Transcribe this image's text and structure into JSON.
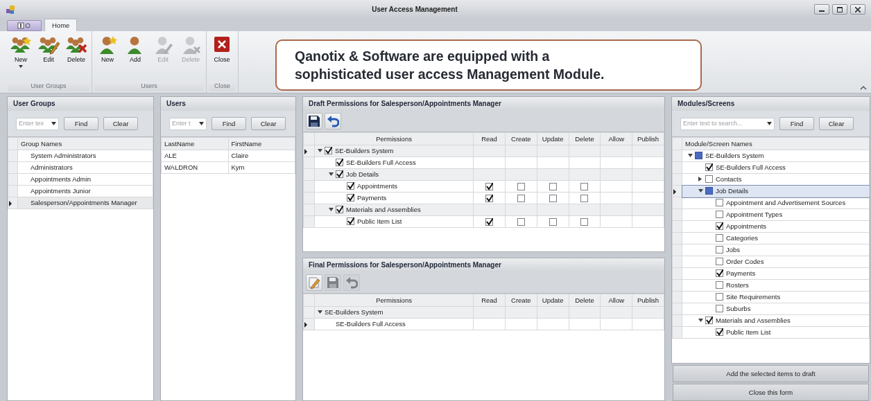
{
  "window": {
    "title": "User Access Management"
  },
  "ribbon": {
    "tabs": [
      {
        "label": "Home",
        "selected": true
      }
    ],
    "groups": [
      {
        "label": "User Groups",
        "buttons": [
          {
            "label": "New",
            "kind": "group-new",
            "disabled": false,
            "dropdown": true
          },
          {
            "label": "Edit",
            "kind": "group-edit",
            "disabled": false,
            "dropdown": false
          },
          {
            "label": "Delete",
            "kind": "group-delete",
            "disabled": false,
            "dropdown": false
          }
        ]
      },
      {
        "label": "Users",
        "buttons": [
          {
            "label": "New",
            "kind": "user-new",
            "disabled": false,
            "dropdown": false
          },
          {
            "label": "Add",
            "kind": "user",
            "disabled": false,
            "dropdown": false
          },
          {
            "label": "Edit",
            "kind": "user-edit",
            "disabled": true,
            "dropdown": false
          },
          {
            "label": "Delete",
            "kind": "user-delete",
            "disabled": true,
            "dropdown": false
          }
        ]
      },
      {
        "label": "Close",
        "buttons": [
          {
            "label": "Close",
            "kind": "close",
            "disabled": false,
            "dropdown": false
          }
        ]
      }
    ],
    "callout": {
      "lines": [
        "Qanotix & Software are equipped with a",
        "sophisticated user access Management Module."
      ]
    }
  },
  "user_groups": {
    "title": "User Groups",
    "search": {
      "placeholder": "Enter tex"
    },
    "find": "Find",
    "clear": "Clear",
    "column": "Group Names",
    "rows": [
      {
        "name": "System Administrators",
        "selected": false
      },
      {
        "name": "Administrators",
        "selected": false
      },
      {
        "name": "Appointments Admin",
        "selected": false
      },
      {
        "name": "Appointments Junior",
        "selected": false
      },
      {
        "name": "Salesperson/Appointments Manager",
        "selected": true
      }
    ]
  },
  "users": {
    "title": "Users",
    "search": {
      "placeholder": "Enter t"
    },
    "find": "Find",
    "clear": "Clear",
    "columns": [
      "LastName",
      "FirstName"
    ],
    "rows": [
      [
        "ALE",
        "Claire"
      ],
      [
        "WALDRON",
        "Kym"
      ]
    ]
  },
  "draft": {
    "title": "Draft Permissions for Salesperson/Appointments Manager",
    "toolbar": [
      {
        "kind": "save",
        "disabled": false
      },
      {
        "kind": "undo",
        "disabled": false
      }
    ],
    "columns": [
      "Permissions",
      "Read",
      "Create",
      "Update",
      "Delete",
      "Allow",
      "Publish"
    ],
    "rows": [
      {
        "label": "SE-Builders System",
        "checked": true,
        "expanded": true,
        "current": true,
        "children": [
          {
            "label": "SE-Builders Full Access",
            "checked": true,
            "current": false
          },
          {
            "label": "Job Details",
            "checked": true,
            "expanded": true,
            "current": false,
            "children": [
              {
                "label": "Appointments",
                "checked": true,
                "current": false,
                "perms": [
                  true,
                  false,
                  false,
                  false
                ]
              },
              {
                "label": "Payments",
                "checked": true,
                "current": false,
                "perms": [
                  true,
                  false,
                  false,
                  false
                ]
              }
            ]
          },
          {
            "label": "Materials and Assemblies",
            "checked": true,
            "expanded": true,
            "current": false,
            "children": [
              {
                "label": "Public Item List",
                "checked": true,
                "current": false,
                "perms": [
                  true,
                  false,
                  false,
                  false
                ]
              }
            ]
          }
        ]
      }
    ]
  },
  "final": {
    "title": "Final Permissions for Salesperson/Appointments Manager",
    "toolbar": [
      {
        "kind": "edit",
        "disabled": false
      },
      {
        "kind": "save",
        "disabled": true
      },
      {
        "kind": "undo",
        "disabled": true
      }
    ],
    "columns": [
      "Permissions",
      "Read",
      "Create",
      "Update",
      "Delete",
      "Allow",
      "Publish"
    ],
    "rows": [
      {
        "label": "SE-Builders System",
        "expanded": true,
        "current": false,
        "children": [
          {
            "label": "SE-Builders Full Access",
            "current": true
          }
        ]
      }
    ]
  },
  "modules": {
    "title": "Modules/Screens",
    "search": {
      "placeholder": "Enter text to search..."
    },
    "find": "Find",
    "clear": "Clear",
    "column": "Module/Screen Names",
    "rows": [
      {
        "label": "SE-Builders System",
        "checked": false,
        "indeterminate": true,
        "expanded": true,
        "current": false,
        "children": [
          {
            "label": "SE-Builders Full Access",
            "checked": true,
            "current": false
          },
          {
            "label": "Contacts",
            "checked": false,
            "indeterminate": false,
            "expanded": false,
            "current": false
          },
          {
            "label": "Job Details",
            "checked": false,
            "indeterminate": true,
            "expanded": true,
            "current": true,
            "children": [
              {
                "label": "Appointment and Advertisement Sources",
                "checked": false,
                "current": false
              },
              {
                "label": "Appointment Types",
                "checked": false,
                "current": false
              },
              {
                "label": "Appointments",
                "checked": true,
                "current": false
              },
              {
                "label": "Categories",
                "checked": false,
                "current": false
              },
              {
                "label": "Jobs",
                "checked": false,
                "current": false
              },
              {
                "label": "Order Codes",
                "checked": false,
                "current": false
              },
              {
                "label": "Payments",
                "checked": true,
                "current": false
              },
              {
                "label": "Rosters",
                "checked": false,
                "current": false
              },
              {
                "label": "Site Requirements",
                "checked": false,
                "current": false
              },
              {
                "label": "Suburbs",
                "checked": false,
                "current": false
              }
            ]
          },
          {
            "label": "Materials and Assemblies",
            "checked": true,
            "indeterminate": false,
            "expanded": true,
            "current": false,
            "children": [
              {
                "label": "Public Item List",
                "checked": true,
                "current": false
              }
            ]
          }
        ]
      }
    ],
    "buttons": [
      "Add the selected items to draft",
      "Close this form"
    ]
  }
}
